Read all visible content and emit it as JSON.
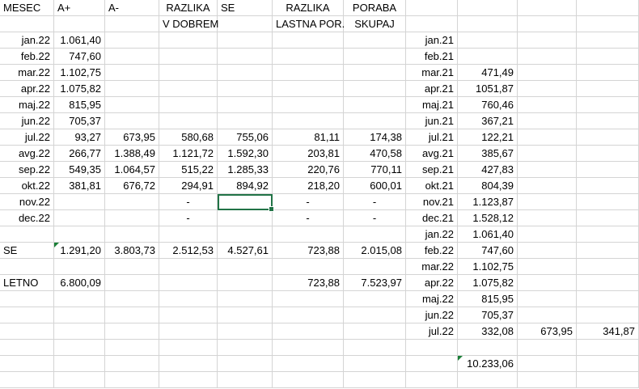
{
  "sheet": {
    "header_row1": {
      "month": "MESEC",
      "a_plus": "A+",
      "a_minus": "A-",
      "razlika1": "RAZLIKA",
      "se": "SE",
      "razlika2": "RAZLIKA",
      "poraba": "PORABA"
    },
    "header_row2": {
      "v_dobrem": "V DOBREM",
      "lastna": "LASTNA POR.",
      "skupaj": "SKUPAJ"
    },
    "rows": [
      [
        "jan.22",
        "1.061,40",
        "",
        "",
        "",
        "",
        ""
      ],
      [
        "feb.22",
        "747,60",
        "",
        "",
        "",
        "",
        ""
      ],
      [
        "mar.22",
        "1.102,75",
        "",
        "",
        "",
        "",
        ""
      ],
      [
        "apr.22",
        "1.075,82",
        "",
        "",
        "",
        "",
        ""
      ],
      [
        "maj.22",
        "815,95",
        "",
        "",
        "",
        "",
        ""
      ],
      [
        "jun.22",
        "705,37",
        "",
        "",
        "",
        "",
        ""
      ],
      [
        "jul.22",
        "93,27",
        "673,95",
        "580,68",
        "755,06",
        "81,11",
        "174,38"
      ],
      [
        "avg.22",
        "266,77",
        "1.388,49",
        "1.121,72",
        "1.592,30",
        "203,81",
        "470,58"
      ],
      [
        "sep.22",
        "549,35",
        "1.064,57",
        "515,22",
        "1.285,33",
        "220,76",
        "770,11"
      ],
      [
        "okt.22",
        "381,81",
        "676,72",
        "294,91",
        "894,92",
        "218,20",
        "600,01"
      ],
      [
        "nov.22",
        "",
        "",
        "-",
        "",
        "-",
        "-"
      ],
      [
        "dec.22",
        "",
        "",
        "-",
        "",
        "-",
        "-"
      ]
    ],
    "se_row": [
      "SE",
      "1.291,20",
      "3.803,73",
      "2.512,53",
      "4.527,61",
      "723,88",
      "2.015,08"
    ],
    "letno_row": [
      "LETNO",
      "6.800,09",
      "",
      "",
      "",
      "723,88",
      "7.523,97"
    ],
    "right_rows": [
      [
        "jan.21",
        "",
        "",
        ""
      ],
      [
        "feb.21",
        "",
        "",
        ""
      ],
      [
        "mar.21",
        "471,49",
        "",
        ""
      ],
      [
        "apr.21",
        "1051,87",
        "",
        ""
      ],
      [
        "maj.21",
        "760,46",
        "",
        ""
      ],
      [
        "jun.21",
        "367,21",
        "",
        ""
      ],
      [
        "jul.21",
        "122,21",
        "",
        ""
      ],
      [
        "avg.21",
        "385,67",
        "",
        ""
      ],
      [
        "sep.21",
        "427,83",
        "",
        ""
      ],
      [
        "okt.21",
        "804,39",
        "",
        ""
      ],
      [
        "nov.21",
        "1.123,87",
        "",
        ""
      ],
      [
        "dec.21",
        "1.528,12",
        "",
        ""
      ],
      [
        "jan.22",
        "1.061,40",
        "",
        ""
      ],
      [
        "feb.22",
        "747,60",
        "",
        ""
      ],
      [
        "mar.22",
        "1.102,75",
        "",
        ""
      ],
      [
        "apr.22",
        "1.075,82",
        "",
        ""
      ],
      [
        "maj.22",
        "815,95",
        "",
        ""
      ],
      [
        "jun.22",
        "705,37",
        "",
        ""
      ],
      [
        "jul.22",
        "332,08",
        "673,95",
        "341,87"
      ]
    ],
    "grand_total": "10.233,06",
    "colors": {
      "grid": "#d4d4d4",
      "selection": "#217346",
      "comment_flag": "#1a7f37"
    }
  }
}
